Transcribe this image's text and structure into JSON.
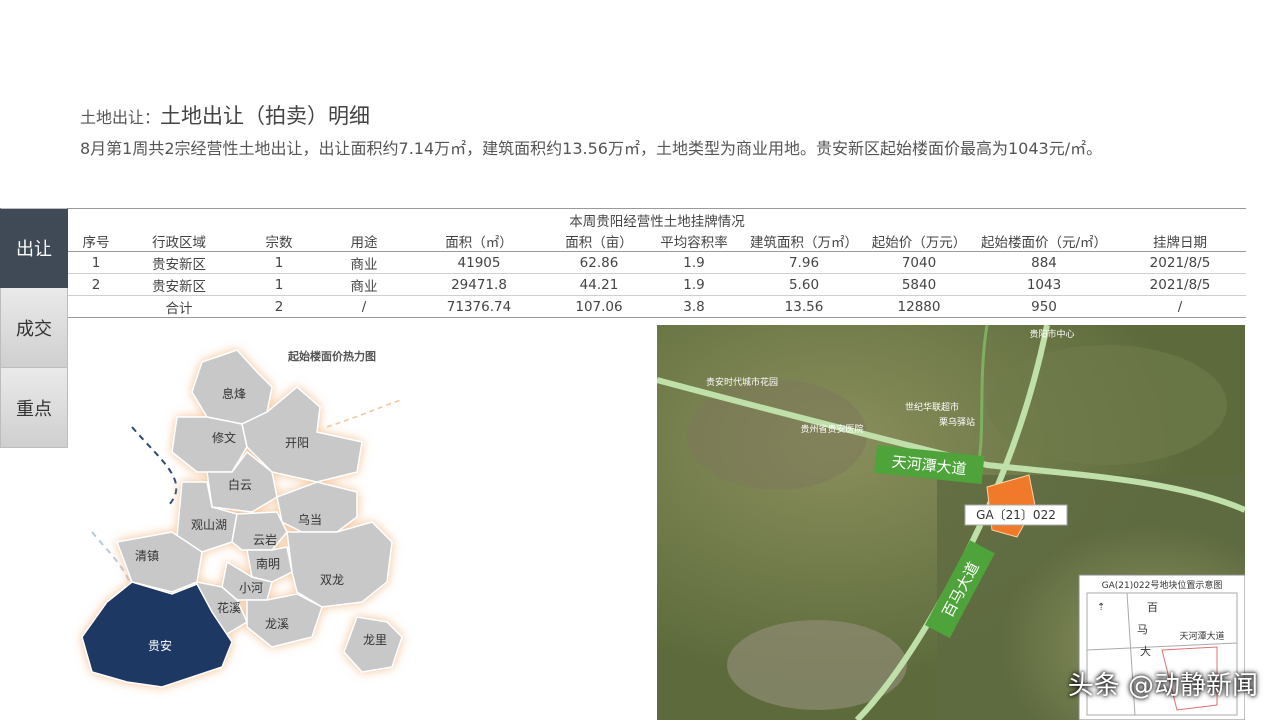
{
  "header": {
    "prefix": "土地出让：",
    "title": "土地出让（拍卖）明细",
    "description": "8月第1周共2宗经营性土地出让，出让面积约7.14万㎡，建筑面积约13.56万㎡，土地类型为商业用地。贵安新区起始楼面价最高为1043元/㎡。"
  },
  "tabs": [
    {
      "label": "出让",
      "active": true
    },
    {
      "label": "成交",
      "active": false
    },
    {
      "label": "重点",
      "active": false
    }
  ],
  "table": {
    "caption": "本周贵阳经营性土地挂牌情况",
    "columns": [
      "序号",
      "行政区域",
      "宗数",
      "用途",
      "面积（㎡）",
      "面积（亩）",
      "平均容积率",
      "建筑面积（万㎡）",
      "起始价（万元）",
      "起始楼面价（元/㎡）",
      "挂牌日期"
    ],
    "rows": [
      [
        "1",
        "贵安新区",
        "1",
        "商业",
        "41905",
        "62.86",
        "1.9",
        "7.96",
        "7040",
        "884",
        "2021/8/5"
      ],
      [
        "2",
        "贵安新区",
        "1",
        "商业",
        "29471.8",
        "44.21",
        "1.9",
        "5.60",
        "5840",
        "1043",
        "2021/8/5"
      ]
    ],
    "total": [
      "",
      "合计",
      "2",
      "/",
      "71376.74",
      "107.06",
      "3.8",
      "13.56",
      "12880",
      "950",
      "/"
    ]
  },
  "heatmap": {
    "title": "起始楼面价热力图",
    "regions": [
      "息烽",
      "修文",
      "开阳",
      "白云",
      "观山湖",
      "乌当",
      "云岩",
      "清镇",
      "南明",
      "小河",
      "双龙",
      "花溪",
      "龙溪",
      "贵安",
      "龙里"
    ],
    "highlight": "贵安",
    "colors": {
      "highlight": "#1f3864",
      "default": "#c8c8c8"
    }
  },
  "satellite": {
    "road1": "天河潭大道",
    "road2": "百马大道",
    "parcel": "GA〔21〕022",
    "places": [
      "贵安时代城市花园",
      "世纪华联超市",
      "贵州省贵安医院",
      "贵阳市中心",
      "栗乌驿站"
    ],
    "inset_title": "GA(21)022号地块位置示意图",
    "inset_road": "天河潭大道",
    "inset_chars": [
      "百",
      "马",
      "大"
    ]
  },
  "watermark": "头条 @动静新闻"
}
